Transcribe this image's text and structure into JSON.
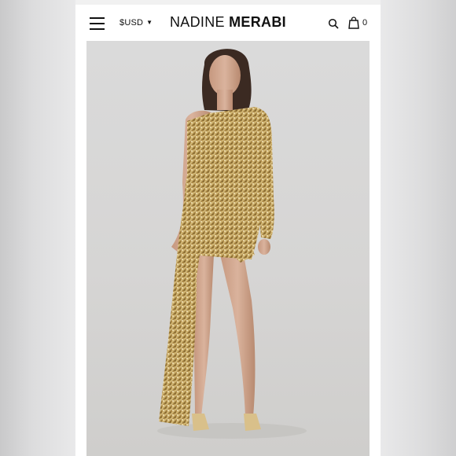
{
  "header": {
    "currency_label": "$USD",
    "brand_light": "NADINE ",
    "brand_bold": "MERABI",
    "cart_count": "0"
  },
  "icons": {
    "menu": "hamburger-icon",
    "currency_dropdown": "chevron-down-icon",
    "search": "search-icon",
    "cart": "shopping-bag-icon"
  },
  "product_image": {
    "alt": "Model wearing a gold sequin one-shoulder mini dress with draped sash",
    "colors": {
      "dress": "#b8954e",
      "background": "#d7d6d4"
    }
  }
}
